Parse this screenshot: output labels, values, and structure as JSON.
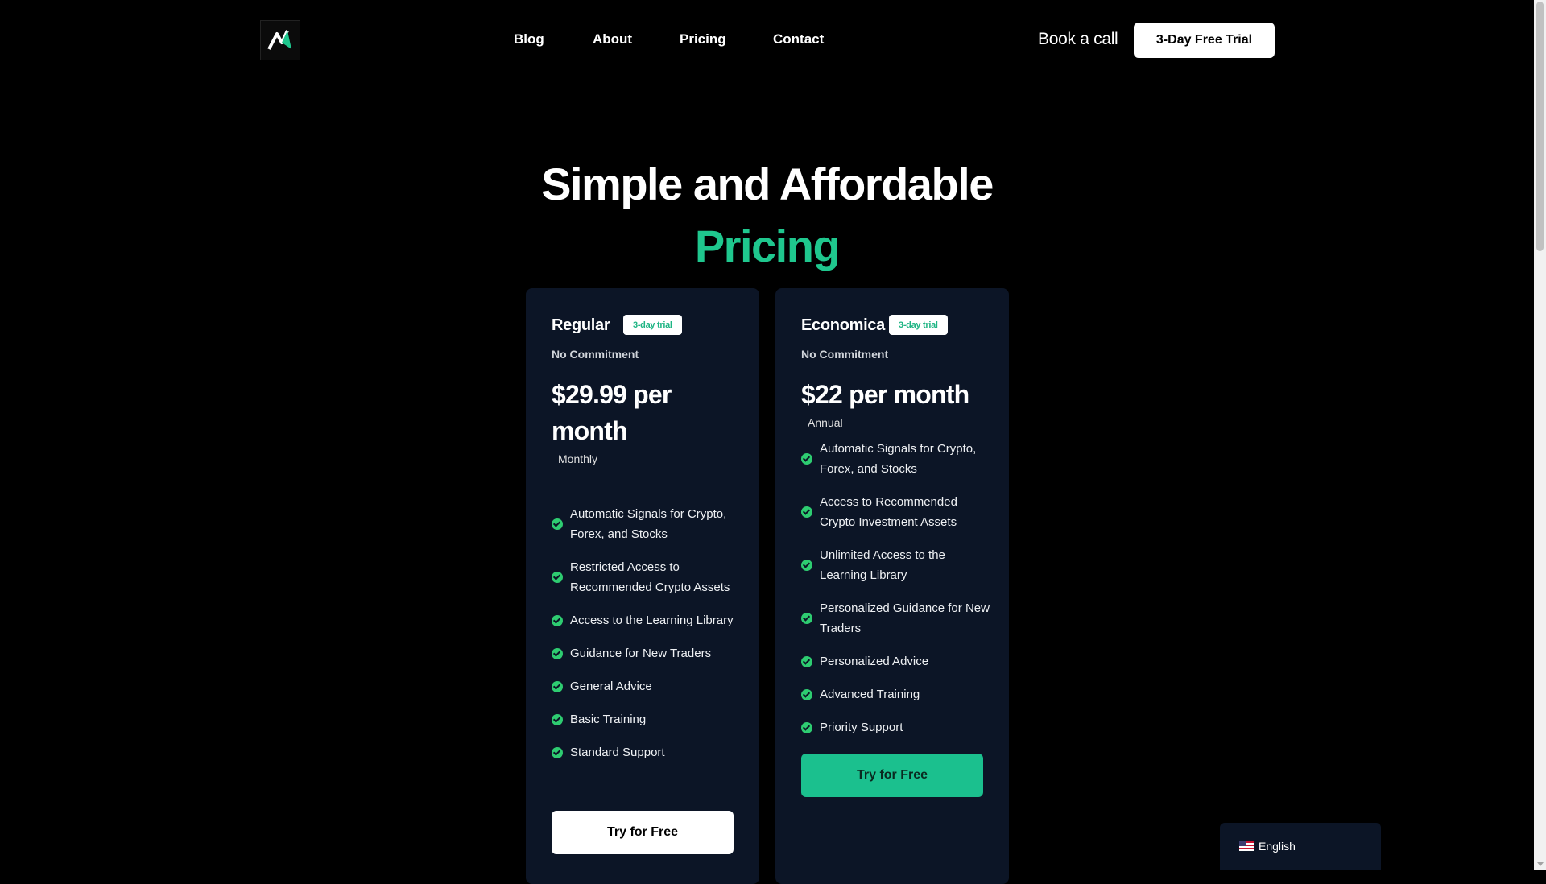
{
  "nav": {
    "links": [
      "Blog",
      "About",
      "Pricing",
      "Contact"
    ],
    "book_call": "Book a call",
    "trial_button": "3-Day Free Trial"
  },
  "hero": {
    "line1": "Simple and Affordable",
    "line2": "Pricing"
  },
  "plans": [
    {
      "name": "Regular",
      "badge": "3-day trial",
      "commitment": "No Commitment",
      "price": "$29.99 per month",
      "period": "Monthly",
      "features": [
        "Automatic Signals for Crypto, Forex, and Stocks",
        "Restricted Access to Recommended Crypto Assets",
        "Access to the Learning Library",
        "Guidance for New Traders",
        "General Advice",
        "Basic Training",
        "Standard Support"
      ],
      "cta": "Try for Free"
    },
    {
      "name": "Economica",
      "badge": "3-day trial",
      "commitment": "No Commitment",
      "price": "$22 per month",
      "period": "Annual",
      "features": [
        "Automatic Signals for Crypto, Forex, and Stocks",
        "Access to Recommended Crypto Investment Assets",
        "Unlimited Access to the Learning Library",
        "Personalized Guidance for New Traders",
        "Personalized Advice",
        "Advanced Training",
        "Priority Support"
      ],
      "cta": "Try for Free"
    }
  ],
  "language": {
    "label": "English",
    "flag_icon": "us-flag-icon"
  },
  "colors": {
    "accent": "#1fc78e",
    "card_bg": "#0c1526",
    "check": "#2ecc71"
  }
}
